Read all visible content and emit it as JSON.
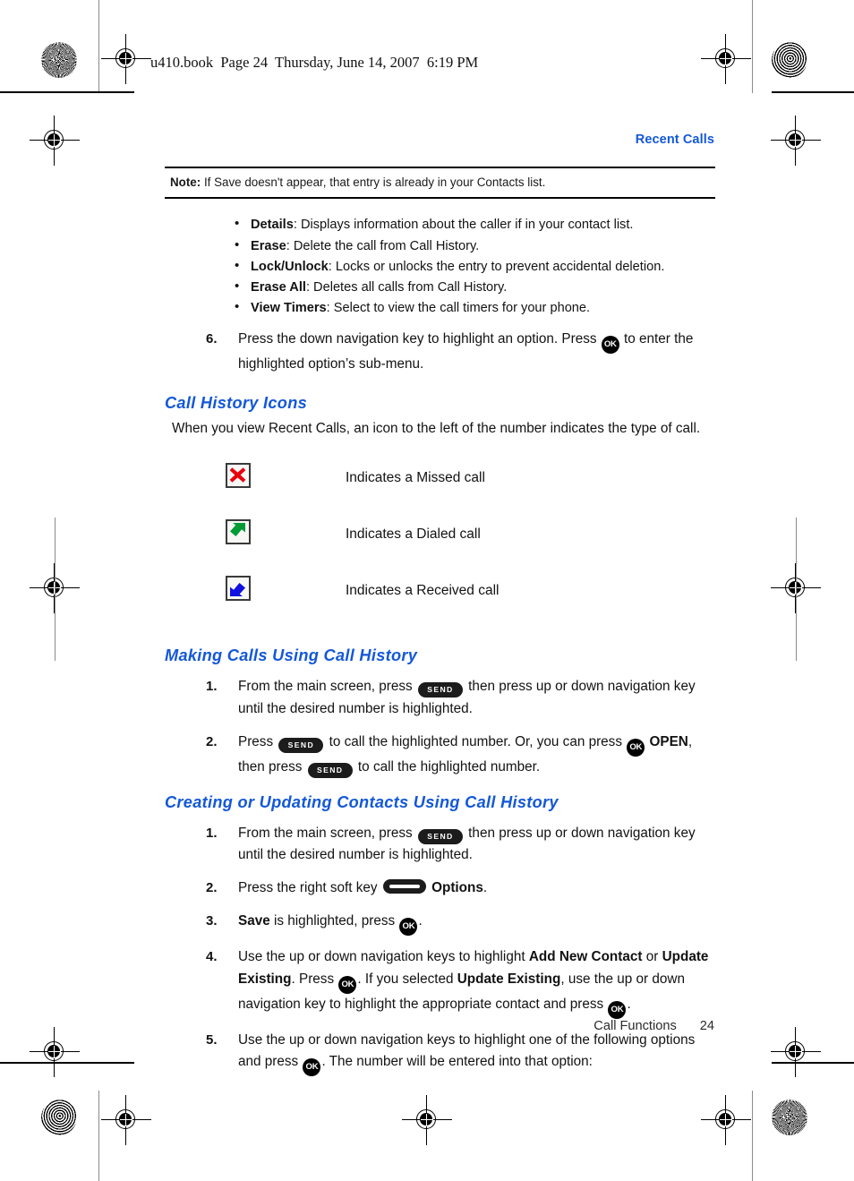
{
  "print_marks": {
    "slugline": "u410.book  Page 24  Thursday, June 14, 2007  6:19 PM"
  },
  "header": {
    "running_head": "Recent Calls"
  },
  "note": {
    "label": "Note:",
    "text": " If Save doesn't appear, that entry is already in your Contacts list."
  },
  "options_list": [
    {
      "term": "Details",
      "desc": ": Displays information about the caller if in your contact list."
    },
    {
      "term": "Erase",
      "desc": ": Delete the call from Call History."
    },
    {
      "term": "Lock/Unlock",
      "desc": ": Locks or unlocks the entry to prevent accidental deletion."
    },
    {
      "term": "Erase All",
      "desc": ": Deletes all calls from Call History."
    },
    {
      "term": "View Timers",
      "desc": ": Select to view the call timers for your phone."
    }
  ],
  "step6": {
    "num": "6.",
    "part1": "Press the down navigation key to highlight an option. Press ",
    "part2": " to enter the highlighted option’s sub-menu."
  },
  "section_icons": {
    "heading": "Call History Icons",
    "intro": "When you view Recent Calls, an icon to the left of the number indicates the type of call.",
    "rows": [
      {
        "icon": "missed-call-icon",
        "color": "#e8000d",
        "label": "Indicates a Missed call"
      },
      {
        "icon": "dialed-call-icon",
        "color": "#009a34",
        "label": "Indicates a Dialed call"
      },
      {
        "icon": "received-call-icon",
        "color": "#1010e0",
        "label": "Indicates a Received call"
      }
    ]
  },
  "section_making": {
    "heading": "Making Calls Using Call History",
    "steps": [
      {
        "num": "1.",
        "segments": [
          {
            "type": "text",
            "value": "From the main screen, press "
          },
          {
            "type": "key",
            "value": "SEND"
          },
          {
            "type": "text",
            "value": " then press up or down navigation key until the desired number is highlighted."
          }
        ]
      },
      {
        "num": "2.",
        "segments": [
          {
            "type": "text",
            "value": "Press "
          },
          {
            "type": "key",
            "value": "SEND"
          },
          {
            "type": "text",
            "value": " to call the highlighted number. Or, you can press "
          },
          {
            "type": "key",
            "value": "OK"
          },
          {
            "type": "bold",
            "value": " OPEN"
          },
          {
            "type": "text",
            "value": ", then press "
          },
          {
            "type": "key",
            "value": "SEND"
          },
          {
            "type": "text",
            "value": " to call the highlighted number."
          }
        ]
      }
    ]
  },
  "section_creating": {
    "heading": "Creating or Updating Contacts Using Call History",
    "steps": [
      {
        "num": "1.",
        "segments": [
          {
            "type": "text",
            "value": "From the main screen, press "
          },
          {
            "type": "key",
            "value": "SEND"
          },
          {
            "type": "text",
            "value": " then press up or down navigation key until the desired number is highlighted."
          }
        ]
      },
      {
        "num": "2.",
        "segments": [
          {
            "type": "text",
            "value": "Press the right soft key "
          },
          {
            "type": "key",
            "value": "SOFT"
          },
          {
            "type": "bold",
            "value": " Options"
          },
          {
            "type": "text",
            "value": "."
          }
        ]
      },
      {
        "num": "3.",
        "segments": [
          {
            "type": "bold",
            "value": "Save"
          },
          {
            "type": "text",
            "value": " is highlighted, press "
          },
          {
            "type": "key",
            "value": "OK"
          },
          {
            "type": "text",
            "value": "."
          }
        ]
      },
      {
        "num": "4.",
        "segments": [
          {
            "type": "text",
            "value": "Use the up or down navigation keys to highlight "
          },
          {
            "type": "bold",
            "value": "Add New Contact"
          },
          {
            "type": "text",
            "value": " or "
          },
          {
            "type": "bold",
            "value": "Update Existing"
          },
          {
            "type": "text",
            "value": ". Press "
          },
          {
            "type": "key",
            "value": "OK"
          },
          {
            "type": "text",
            "value": ". If you selected "
          },
          {
            "type": "bold",
            "value": "Update Existing"
          },
          {
            "type": "text",
            "value": ", use the up or down navigation key to highlight the appropriate contact and press "
          },
          {
            "type": "key",
            "value": "OK"
          },
          {
            "type": "text",
            "value": "."
          }
        ]
      },
      {
        "num": "5.",
        "segments": [
          {
            "type": "text",
            "value": "Use the up or down navigation keys to highlight one of the following options and press "
          },
          {
            "type": "key",
            "value": "OK"
          },
          {
            "type": "text",
            "value": ". The number will be entered into that option:"
          }
        ]
      }
    ]
  },
  "footer": {
    "chapter": "Call Functions",
    "page_number": "24"
  },
  "colors": {
    "heading_blue": "#1358d8",
    "text_black": "#121212",
    "rule_black": "#000000"
  }
}
